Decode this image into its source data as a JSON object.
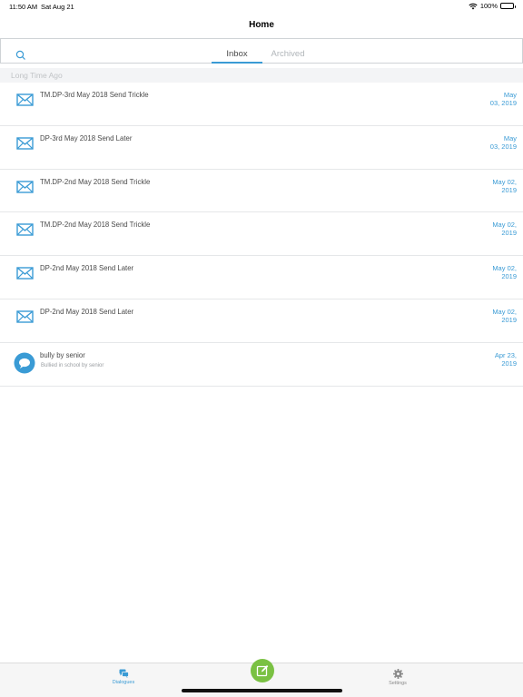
{
  "status_bar": {
    "time": "11:50 AM",
    "date": "Sat Aug 21",
    "battery": "100%"
  },
  "nav": {
    "title": "Home"
  },
  "tabs": [
    {
      "label": "Inbox",
      "active": true
    },
    {
      "label": "Archived",
      "active": false
    }
  ],
  "section": {
    "header": "Long Time Ago"
  },
  "messages": [
    {
      "type": "envelope-icon",
      "title": "TM.DP-3rd May 2018 Send Trickle",
      "subtitle": "",
      "date_line1": "May",
      "date_line2": "03, 2019"
    },
    {
      "type": "envelope-icon",
      "title": "DP-3rd May 2018 Send Later",
      "subtitle": "",
      "date_line1": "May",
      "date_line2": "03, 2019"
    },
    {
      "type": "envelope-icon",
      "title": "TM.DP-2nd May 2018 Send Trickle",
      "subtitle": "",
      "date_line1": "May 02,",
      "date_line2": "2019"
    },
    {
      "type": "envelope-icon",
      "title": "TM.DP-2nd May 2018 Send Trickle",
      "subtitle": "",
      "date_line1": "May 02,",
      "date_line2": "2019"
    },
    {
      "type": "envelope-icon",
      "title": "DP-2nd May 2018 Send Later",
      "subtitle": "",
      "date_line1": "May 02,",
      "date_line2": "2019"
    },
    {
      "type": "envelope-icon",
      "title": "DP-2nd May 2018 Send Later",
      "subtitle": "",
      "date_line1": "May 02,",
      "date_line2": "2019"
    },
    {
      "type": "chat-bubble-icon",
      "title": "bully by senior",
      "subtitle": "Bullied in school by senior",
      "date_line1": "Apr 23,",
      "date_line2": "2019"
    }
  ],
  "tab_bar": {
    "dialogues_label": "Dialogues",
    "settings_label": "Settings"
  },
  "colors": {
    "accent": "#3a9bd5",
    "compose": "#7ac143"
  }
}
